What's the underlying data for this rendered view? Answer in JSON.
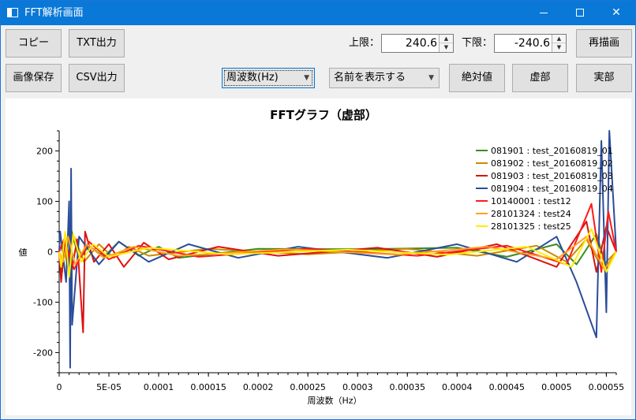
{
  "window": {
    "title": "FFT解析画面",
    "controls": {
      "minimize": "—",
      "maximize": "□",
      "close": "✕"
    }
  },
  "toolbar": {
    "copy_label": "コピー",
    "txt_label": "TXT出力",
    "save_image_label": "画像保存",
    "csv_label": "CSV出力",
    "upper_label": "上限：",
    "upper_value": "240.6",
    "lower_label": "下限：",
    "lower_value": "-240.6",
    "redraw_label": "再描画",
    "xaxis_select": "周波数(Hz)",
    "name_select": "名前を表示する",
    "abs_label": "絶対値",
    "imag_label": "虚部",
    "real_label": "実部"
  },
  "colors": {
    "titlebar": "#0a78d7",
    "s1": "#3a8c1f",
    "s2": "#cc8a00",
    "s3": "#dd1111",
    "s4": "#2a4d9a",
    "s5": "#ff1a1a",
    "s6": "#ffa020",
    "s7": "#ffee00"
  },
  "chart_data": {
    "type": "line",
    "title": "FFTグラフ（虚部）",
    "xlabel": "周波数（Hz）",
    "ylabel": "値",
    "xlim": [
      0,
      0.00056
    ],
    "ylim": [
      -240,
      240
    ],
    "xticks": [
      0,
      5e-05,
      0.0001,
      0.00015,
      0.0002,
      0.00025,
      0.0003,
      0.00035,
      0.0004,
      0.00045,
      0.0005,
      0.00055
    ],
    "xtick_labels": [
      "0",
      "5E-05",
      "0.0001",
      "0.00015",
      "0.0002",
      "0.00025",
      "0.0003",
      "0.00035",
      "0.0004",
      "0.00045",
      "0.0005",
      "0.00055"
    ],
    "yticks": [
      -200,
      -100,
      0,
      100,
      200
    ],
    "ytick_labels": [
      "-200",
      "-100",
      "0",
      "100",
      "200"
    ],
    "legend_position": "top-right",
    "series": [
      {
        "name": "081901 : test_20160819_01",
        "color": "#3a8c1f",
        "points": [
          [
            3e-06,
            -40
          ],
          [
            5e-06,
            25
          ],
          [
            1e-05,
            -30
          ],
          [
            1.2e-05,
            45
          ],
          [
            2e-05,
            -15
          ],
          [
            3e-05,
            12
          ],
          [
            4.5e-05,
            -10
          ],
          [
            6e-05,
            20
          ],
          [
            8e-05,
            -8
          ],
          [
            0.0001,
            10
          ],
          [
            0.00012,
            -12
          ],
          [
            0.0002,
            6
          ],
          [
            0.0003,
            5
          ],
          [
            0.0004,
            8
          ],
          [
            0.00045,
            -10
          ],
          [
            0.0005,
            15
          ],
          [
            0.00052,
            -25
          ],
          [
            0.00054,
            35
          ],
          [
            0.00055,
            -30
          ]
        ]
      },
      {
        "name": "081902 : test_20160819_02",
        "color": "#cc8a00",
        "points": [
          [
            4e-06,
            20
          ],
          [
            8e-06,
            -25
          ],
          [
            1.5e-05,
            30
          ],
          [
            2.5e-05,
            -20
          ],
          [
            4e-05,
            15
          ],
          [
            5.5e-05,
            -12
          ],
          [
            7e-05,
            10
          ],
          [
            9e-05,
            -8
          ],
          [
            0.00015,
            6
          ],
          [
            0.00025,
            -5
          ],
          [
            0.00035,
            6
          ],
          [
            0.00042,
            -8
          ],
          [
            0.00048,
            12
          ],
          [
            0.00051,
            -20
          ],
          [
            0.00053,
            25
          ],
          [
            0.000545,
            -30
          ]
        ]
      },
      {
        "name": "081903 : test_20160819_03",
        "color": "#dd1111",
        "points": [
          [
            2e-06,
            -60
          ],
          [
            6e-06,
            35
          ],
          [
            1.2e-05,
            -45
          ],
          [
            1.8e-05,
            25
          ],
          [
            2.4e-05,
            -160
          ],
          [
            2.6e-05,
            40
          ],
          [
            3.5e-05,
            -20
          ],
          [
            5e-05,
            15
          ],
          [
            6.5e-05,
            -30
          ],
          [
            8.5e-05,
            18
          ],
          [
            0.00011,
            -15
          ],
          [
            0.00016,
            10
          ],
          [
            0.00022,
            -8
          ],
          [
            0.00032,
            8
          ],
          [
            0.00038,
            -10
          ],
          [
            0.00044,
            15
          ],
          [
            0.0005,
            -30
          ],
          [
            0.00053,
            60
          ],
          [
            0.00054,
            -40
          ],
          [
            0.00055,
            50
          ]
        ]
      },
      {
        "name": "081904 : test_20160819_04",
        "color": "#2a4d9a",
        "points": [
          [
            1e-06,
            40
          ],
          [
            7e-06,
            -60
          ],
          [
            1e-05,
            100
          ],
          [
            1.1e-05,
            -230
          ],
          [
            1.2e-05,
            165
          ],
          [
            1.3e-05,
            -145
          ],
          [
            2e-05,
            30
          ],
          [
            4e-05,
            -25
          ],
          [
            6e-05,
            20
          ],
          [
            9e-05,
            -20
          ],
          [
            0.00013,
            15
          ],
          [
            0.00018,
            -12
          ],
          [
            0.00024,
            10
          ],
          [
            0.00033,
            -12
          ],
          [
            0.0004,
            15
          ],
          [
            0.00046,
            -20
          ],
          [
            0.0005,
            30
          ],
          [
            0.00052,
            -60
          ],
          [
            0.00054,
            -170
          ],
          [
            0.000545,
            220
          ],
          [
            0.00055,
            -120
          ],
          [
            0.000553,
            240
          ]
        ]
      },
      {
        "name": "10140001 : test12",
        "color": "#ff1a1a",
        "points": [
          [
            5e-06,
            25
          ],
          [
            1.5e-05,
            -35
          ],
          [
            3e-05,
            20
          ],
          [
            5e-05,
            -15
          ],
          [
            8e-05,
            12
          ],
          [
            0.00014,
            -10
          ],
          [
            0.00025,
            6
          ],
          [
            0.00036,
            -8
          ],
          [
            0.00045,
            12
          ],
          [
            0.00051,
            -25
          ],
          [
            0.000535,
            95
          ],
          [
            0.000545,
            -40
          ],
          [
            0.000552,
            80
          ]
        ]
      },
      {
        "name": "28101324 : test24",
        "color": "#ffa020",
        "points": [
          [
            4e-06,
            -20
          ],
          [
            9e-06,
            30
          ],
          [
            1.6e-05,
            -25
          ],
          [
            2.8e-05,
            15
          ],
          [
            4.5e-05,
            -12
          ],
          [
            7.5e-05,
            10
          ],
          [
            0.00012,
            -8
          ],
          [
            0.00023,
            5
          ],
          [
            0.00034,
            -6
          ],
          [
            0.00043,
            10
          ],
          [
            0.0005,
            -15
          ],
          [
            0.00053,
            30
          ],
          [
            0.000548,
            -35
          ]
        ]
      },
      {
        "name": "28101325 : test25",
        "color": "#ffee00",
        "points": [
          [
            2e-06,
            -30
          ],
          [
            6e-06,
            40
          ],
          [
            1e-05,
            -50
          ],
          [
            1.4e-05,
            35
          ],
          [
            2.2e-05,
            -20
          ],
          [
            3.4e-05,
            15
          ],
          [
            5e-05,
            -10
          ],
          [
            9e-05,
            8
          ],
          [
            0.00017,
            -5
          ],
          [
            0.00029,
            4
          ],
          [
            0.00039,
            -6
          ],
          [
            0.00047,
            10
          ],
          [
            0.000515,
            -30
          ],
          [
            0.000535,
            45
          ],
          [
            0.00055,
            -40
          ]
        ]
      }
    ]
  }
}
